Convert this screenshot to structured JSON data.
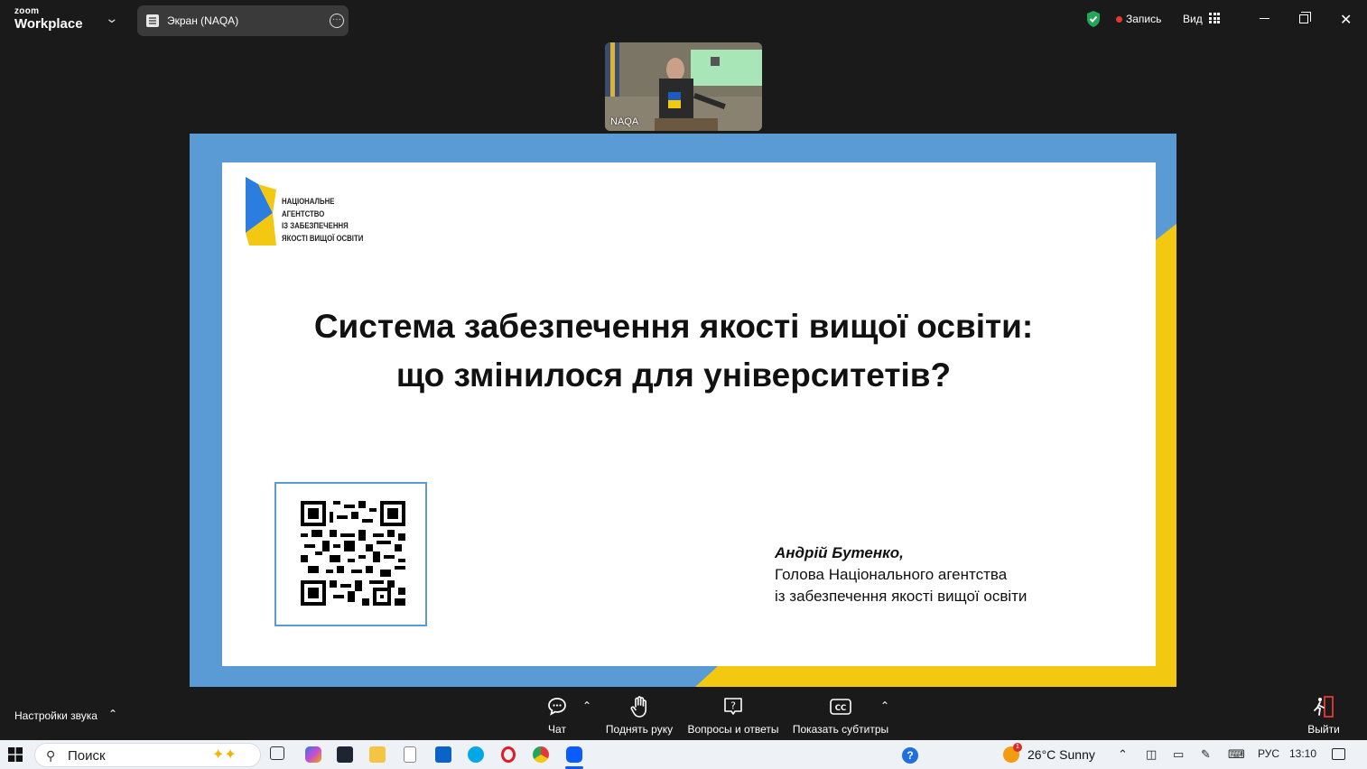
{
  "app": {
    "brand_small": "zoom",
    "brand_big": "Workplace"
  },
  "tab": {
    "label": "Экран (NAQA)"
  },
  "header": {
    "record_label": "Запись",
    "view_label": "Вид"
  },
  "video": {
    "participant_name": "NAQA"
  },
  "slide": {
    "logo_lines": [
      "НАЦІОНАЛЬНЕ",
      "АГЕНТСТВО",
      "ІЗ ЗАБЕЗПЕЧЕННЯ",
      "ЯКОСТІ ВИЩОЇ ОСВІТИ"
    ],
    "title_line1": "Система забезпечення якості вищої освіти:",
    "title_line2": "що змінилося для університетів?",
    "author_name": "Андрій Бутенко,",
    "author_role_line1": "Голова Національного агентства",
    "author_role_line2": "із забезпечення якості вищої освіти"
  },
  "toolbar": {
    "audio_settings": "Настройки звука",
    "chat": "Чат",
    "raise_hand": "Поднять руку",
    "qa": "Вопросы и ответы",
    "captions": "Показать субтитры",
    "leave": "Выйти"
  },
  "taskbar": {
    "search_placeholder": "Поиск",
    "weather": "26°C  Sunny",
    "weather_badge": "1",
    "language": "РУС",
    "time": "13:10"
  },
  "colors": {
    "slide_blue": "#5b9bd5",
    "slide_yellow": "#f2c811",
    "zoom_blue": "#0b5cff",
    "record_red": "#e53935"
  }
}
